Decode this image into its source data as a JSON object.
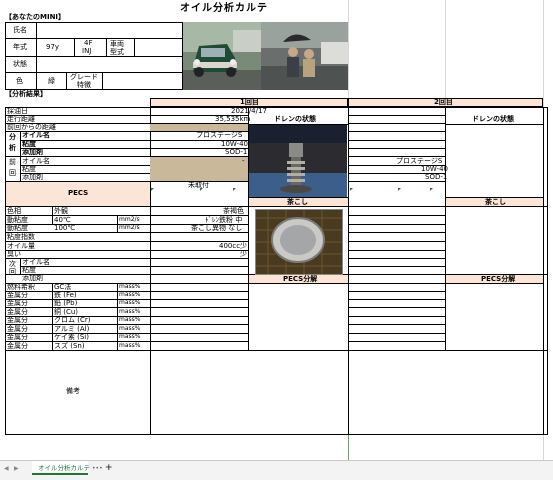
{
  "sheet": {
    "title": "オイル分析カルテ",
    "section_car": "【あなたのMINI】",
    "section_results": "【分析結果】",
    "active_tab": "オイル分析カルテ",
    "more_tabs": "•••",
    "add_tab": "+"
  },
  "car": {
    "name_label": "氏名",
    "year_label": "年式",
    "year_value": "97y",
    "engine_value_1": "4F",
    "engine_value_2": "INJ",
    "model_label": "車両\n型式",
    "condition_label": "状態",
    "color_label": "色",
    "color_value": "緑",
    "grade_label": "グレード\n特徴"
  },
  "results": {
    "round1_header": "1回目",
    "round2_header": "2回目",
    "drain_header": "ドレンの状態",
    "strainer_header": "茶こし",
    "pecs_analysis_header": "PECS分解",
    "rows": {
      "date": "採油日",
      "mileage": "走行距離",
      "since_last": "前回からの距離",
      "analysis_1": "分",
      "analysis_2": "析",
      "oil_name": "オイル名",
      "viscosity": "粘度",
      "additive": "添加剤",
      "prev_1": "前",
      "prev_2": "回",
      "pecs": "PECS",
      "color": "色相",
      "appearance": "外観",
      "kv40": "動粘度",
      "t40": "40℃",
      "kv100": "動粘度",
      "t100": "100℃",
      "vi": "粘度指数",
      "oil_amount": "オイル量",
      "odor": "臭い",
      "next_1": "次",
      "next_2": "回",
      "fuel_dilution": "燃料希釈",
      "gc": "GC法",
      "metal": "金属分",
      "fe": "鉄 (Fe)",
      "pb": "鉛 (Pb)",
      "cu": "銅 (Cu)",
      "cr": "クロム (Cr)",
      "al": "アルミ (Al)",
      "si": "ケイ素 (Si)",
      "sn": "スズ (Sn)",
      "unit_mm2": "mm2/s",
      "unit_mass": "mass%",
      "notes": "備考"
    },
    "r1": {
      "date": "2021/4/17",
      "mileage": "35,535km",
      "oil_name": "プロステージS",
      "viscosity": "10W-40",
      "additive": "SOD-1",
      "prev_dash": "-",
      "pecs": "未取付",
      "color": "茶褐色",
      "kv40": "ﾄﾞﾚﾝ鉄粉 中",
      "kv100": "茶こし異物 なし",
      "oil_amount": "400cc少",
      "odor": "少"
    },
    "r2": {
      "oil_name": "プロステージS",
      "viscosity": "10W-40",
      "additive": "SOD-1"
    }
  }
}
